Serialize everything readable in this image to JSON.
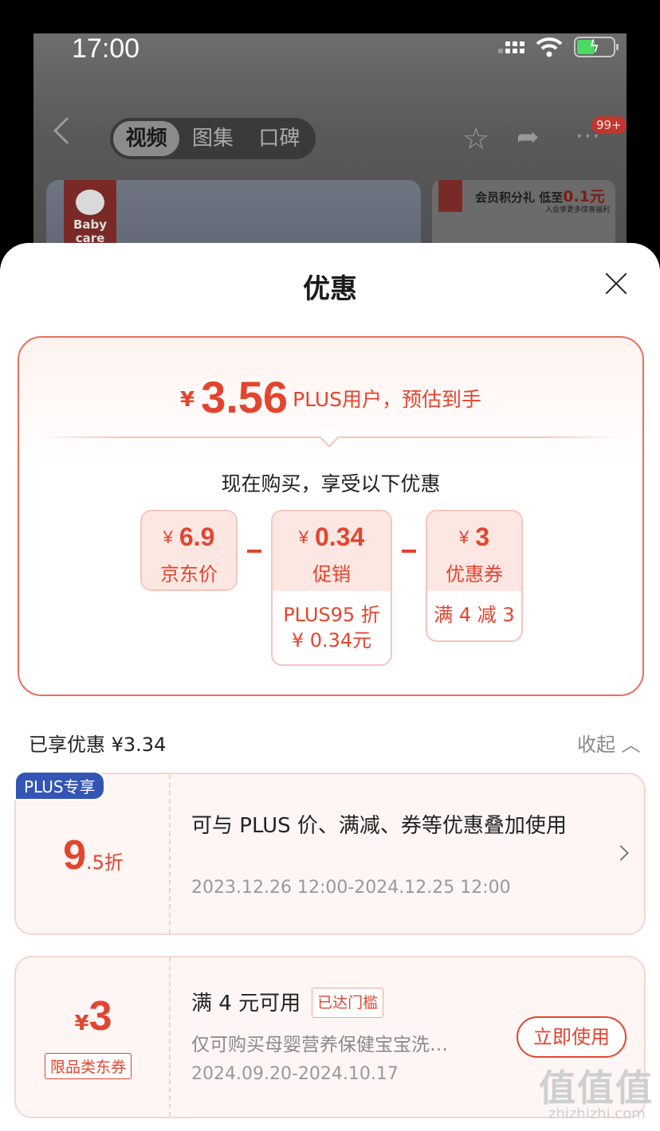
{
  "status_bar": {
    "time": "17:00"
  },
  "background_page": {
    "tabs": [
      {
        "label": "视频"
      },
      {
        "label": "图集"
      },
      {
        "label": "口碑"
      }
    ],
    "badge_count": "99+",
    "brand_logo_text": "Baby care",
    "promo_banner": {
      "text": "会员积分礼 低至",
      "highlight": "0.1元",
      "subtext": "入会享更多惊喜福利"
    }
  },
  "sheet": {
    "title": "优惠",
    "estimate": {
      "currency": "¥",
      "price": "3.56",
      "note": "PLUS用户，预估到手"
    },
    "enjoy_heading": "现在购买，享受以下优惠",
    "breakdown": [
      {
        "currency": "¥",
        "value": "6.9",
        "label": "京东价"
      },
      {
        "currency": "¥",
        "value": "0.34",
        "label": "促销",
        "detail_line1": "PLUS95 折",
        "detail_line2": "¥ 0.34元"
      },
      {
        "currency": "¥",
        "value": "3",
        "label": "优惠券",
        "detail_line1": "满 4 减 3"
      }
    ],
    "enjoyed_summary": "已享优惠 ¥3.34",
    "collapse_label": "收起",
    "offers": [
      {
        "tag": "PLUS专享",
        "discount_big": "9",
        "discount_small": ".5折",
        "title": "可与 PLUS 价、满减、券等优惠叠加使用",
        "date_range": "2023.12.26 12:00-2024.12.25 12:00"
      },
      {
        "coupon_currency": "¥",
        "coupon_value": "3",
        "category_tag": "限品类东券",
        "title": "满 4 元可用",
        "threshold_badge": "已达门槛",
        "description": "仅可购买母婴营养保健宝宝洗…",
        "date_range": "2024.09.20-2024.10.17",
        "action_label": "立即使用"
      }
    ]
  },
  "watermark": {
    "text": "值值值",
    "sub": "zhizhizhi.com"
  },
  "colors": {
    "accent": "#e2452f",
    "plus_blue": "#3455b5",
    "chip_bg": "#fde7e3"
  }
}
